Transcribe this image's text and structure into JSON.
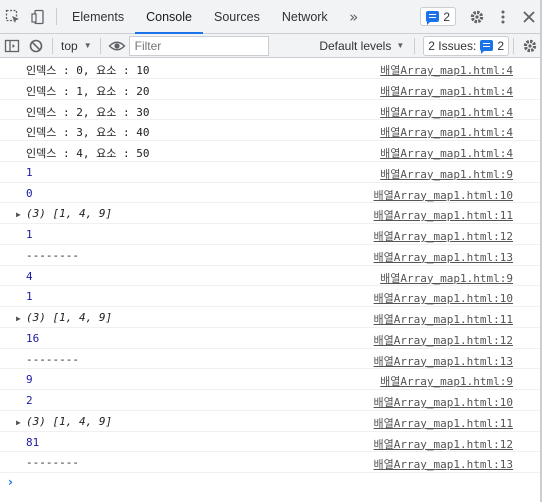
{
  "tabs": {
    "items": [
      "Elements",
      "Console",
      "Sources",
      "Network"
    ],
    "more": "»",
    "issues_count": "2"
  },
  "toolbar": {
    "context": "top",
    "filter_placeholder": "Filter",
    "levels": "Default levels",
    "issues_label": "2 Issues:",
    "issues_count": "2"
  },
  "console": {
    "rows": [
      {
        "text": "인덱스 : 0, 요소 : 10",
        "type": "log",
        "source": "배열Array_map1.html:4"
      },
      {
        "text": "인덱스 : 1, 요소 : 20",
        "type": "log",
        "source": "배열Array_map1.html:4"
      },
      {
        "text": "인덱스 : 2, 요소 : 30",
        "type": "log",
        "source": "배열Array_map1.html:4"
      },
      {
        "text": "인덱스 : 3, 요소 : 40",
        "type": "log",
        "source": "배열Array_map1.html:4"
      },
      {
        "text": "인덱스 : 4, 요소 : 50",
        "type": "log",
        "source": "배열Array_map1.html:4"
      },
      {
        "text": "1",
        "type": "num",
        "source": "배열Array_map1.html:9"
      },
      {
        "text": "0",
        "type": "num",
        "source": "배열Array_map1.html:10"
      },
      {
        "text": "(3) [1, 4, 9]",
        "type": "obj",
        "source": "배열Array_map1.html:11"
      },
      {
        "text": "1",
        "type": "num",
        "source": "배열Array_map1.html:12"
      },
      {
        "text": "--------",
        "type": "log",
        "source": "배열Array_map1.html:13"
      },
      {
        "text": "4",
        "type": "num",
        "source": "배열Array_map1.html:9"
      },
      {
        "text": "1",
        "type": "num",
        "source": "배열Array_map1.html:10"
      },
      {
        "text": "(3) [1, 4, 9]",
        "type": "obj",
        "source": "배열Array_map1.html:11"
      },
      {
        "text": "16",
        "type": "num",
        "source": "배열Array_map1.html:12"
      },
      {
        "text": "--------",
        "type": "log",
        "source": "배열Array_map1.html:13"
      },
      {
        "text": "9",
        "type": "num",
        "source": "배열Array_map1.html:9"
      },
      {
        "text": "2",
        "type": "num",
        "source": "배열Array_map1.html:10"
      },
      {
        "text": "(3) [1, 4, 9]",
        "type": "obj",
        "source": "배열Array_map1.html:11"
      },
      {
        "text": "81",
        "type": "num",
        "source": "배열Array_map1.html:12"
      },
      {
        "text": "--------",
        "type": "log",
        "source": "배열Array_map1.html:13"
      }
    ],
    "prompt": "›"
  },
  "colors": {
    "accent": "#1a73e8",
    "number": "#1a1aa6"
  }
}
